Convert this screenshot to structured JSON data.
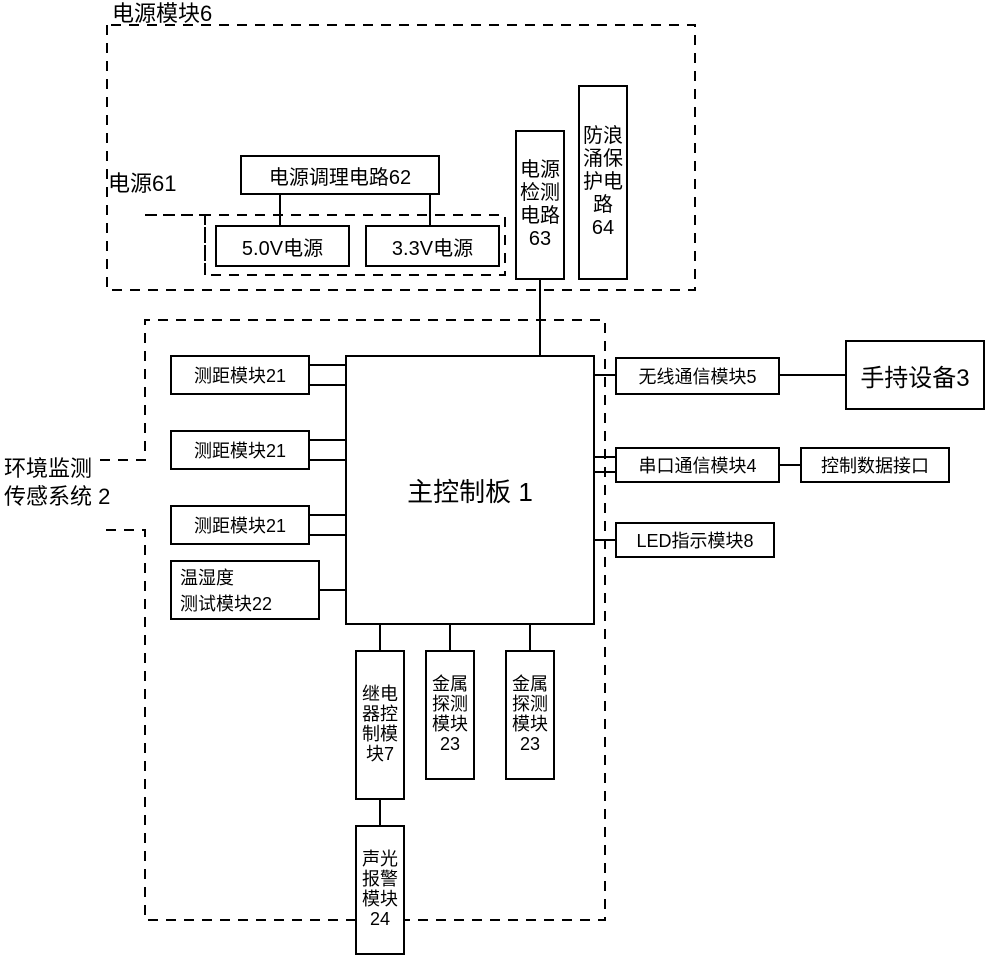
{
  "labels": {
    "power_module_6": "电源模块6",
    "power_61": "电源61",
    "env_system_2": "环境监测\n传感系统 2"
  },
  "blocks": {
    "power_regulation_62": "电源调理电路62",
    "power_5v": "5.0V电源",
    "power_3v3": "3.3V电源",
    "power_detect_63": "电源检测电路63",
    "surge_protect_64": "防浪涌保护电路64",
    "range_21_a": "测距模块21",
    "range_21_b": "测距模块21",
    "range_21_c": "测距模块21",
    "temp_humidity_22": "温湿度\n测试模块22",
    "main_controller_1": "主控制板  1",
    "wireless_5": "无线通信模块5",
    "handheld_3": "手持设备3",
    "serial_4": "串口通信模块4",
    "ctrl_iface": "控制数据接口",
    "led_8": "LED指示模块8",
    "relay_7": "继电器控制模块7",
    "metal_23_a": "金属探测模块23",
    "metal_23_b": "金属探测模块23",
    "alarm_24": "声光报警模块24"
  }
}
